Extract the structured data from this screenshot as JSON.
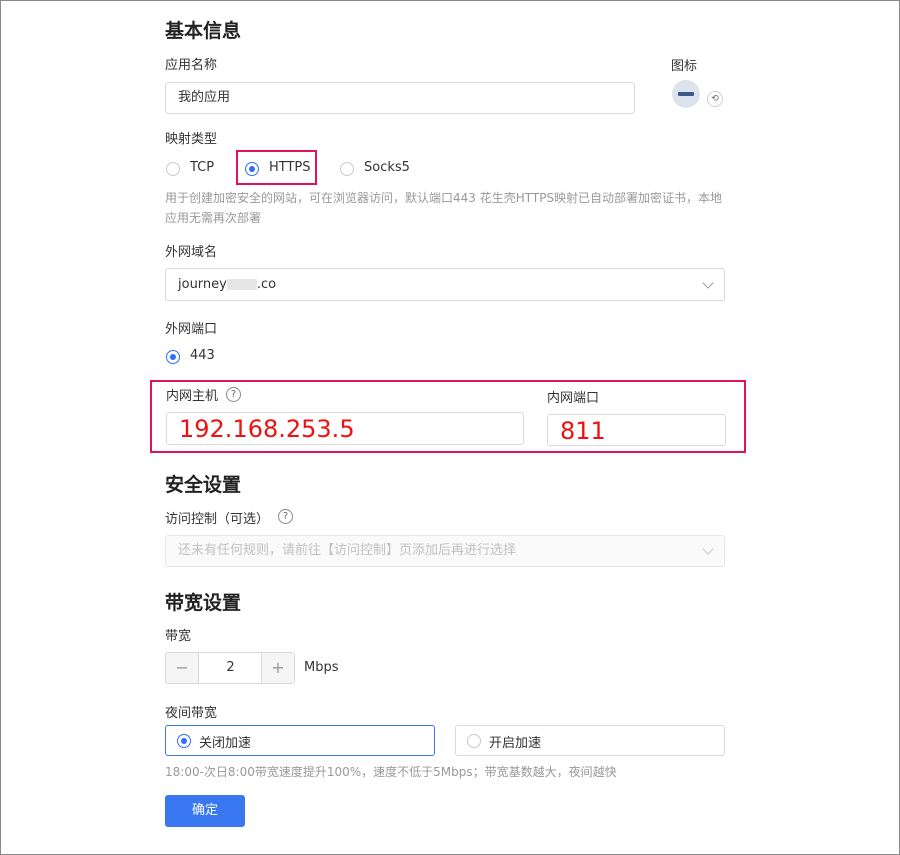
{
  "basic": {
    "heading": "基本信息",
    "app_name_label": "应用名称",
    "app_name_value": "我的应用",
    "icon_label": "图标"
  },
  "mapping": {
    "label": "映射类型",
    "options": [
      "TCP",
      "HTTPS",
      "Socks5"
    ],
    "selected": "HTTPS",
    "help": "用于创建加密安全的网站，可在浏览器访问，默认端口443 花生壳HTTPS映射已自动部署加密证书，本地应用无需再次部署"
  },
  "domain": {
    "label": "外网域名",
    "value_prefix": "journey",
    "value_suffix": ".co"
  },
  "external_port": {
    "label": "外网端口",
    "value": "443"
  },
  "internal": {
    "host_label": "内网主机",
    "host_value": "192.168.253.5",
    "port_label": "内网端口",
    "port_value": "811",
    "help_glyph": "?"
  },
  "security": {
    "heading": "安全设置",
    "access_label": "访问控制（可选）",
    "help_glyph": "?",
    "access_placeholder": "还未有任何规则，请前往【访问控制】页添加后再进行选择"
  },
  "bandwidth": {
    "heading": "带宽设置",
    "label": "带宽",
    "minus": "−",
    "plus": "+",
    "value": "2",
    "unit": "Mbps",
    "night_label": "夜间带宽",
    "night_off": "关闭加速",
    "night_on": "开启加速",
    "night_selected": "关闭加速",
    "help": "18:00-次日8:00带宽速度提升100%，速度不低于5Mbps；带宽基数越大，夜间越快"
  },
  "confirm_label": "确定",
  "colors": {
    "primary": "#3a78f2",
    "highlight_box": "#e3135b",
    "annotation_text": "#ee1111"
  }
}
